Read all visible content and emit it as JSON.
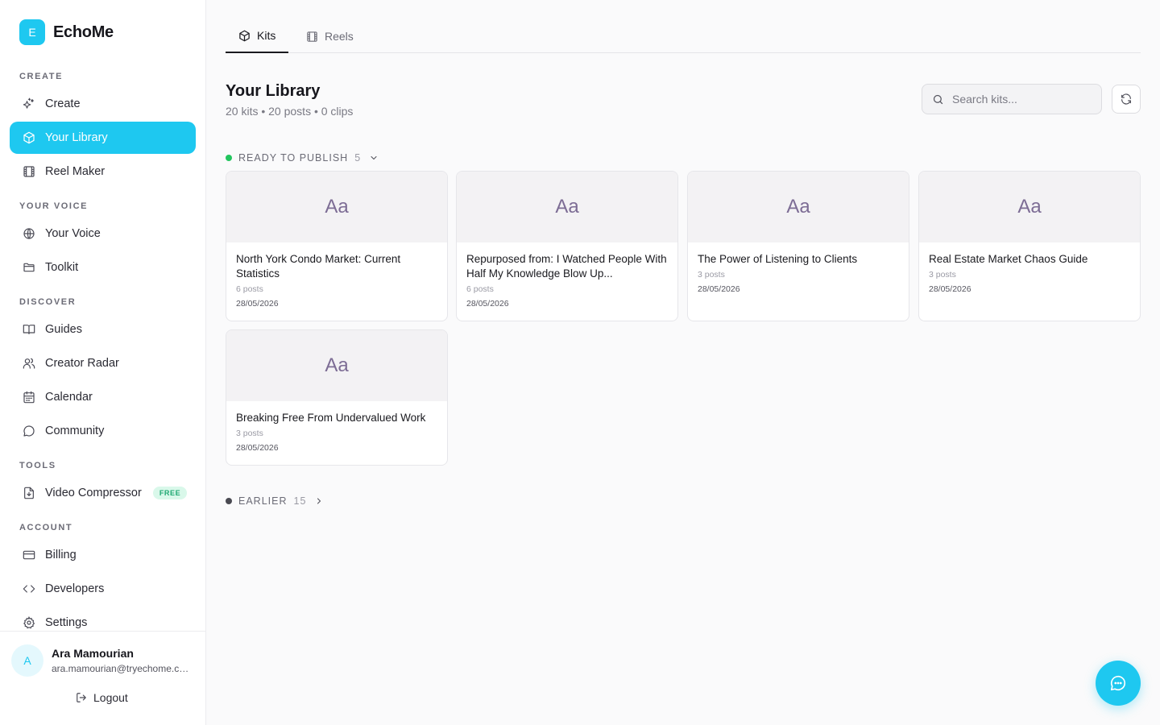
{
  "brand": {
    "logo_letter": "E",
    "name": "EchoMe",
    "accent": "#1ec8f0"
  },
  "sidebar": {
    "sections": {
      "create": "CREATE",
      "your_voice": "YOUR VOICE",
      "discover": "DISCOVER",
      "tools": "TOOLS",
      "account": "ACCOUNT"
    },
    "items": {
      "create": {
        "label": "Create",
        "icon": "sparkles-icon"
      },
      "library": {
        "label": "Your Library",
        "icon": "box-icon",
        "active": true
      },
      "reel_maker": {
        "label": "Reel Maker",
        "icon": "film-icon"
      },
      "your_voice": {
        "label": "Your Voice",
        "icon": "globe-icon"
      },
      "toolkit": {
        "label": "Toolkit",
        "icon": "folder-icon"
      },
      "guides": {
        "label": "Guides",
        "icon": "book-icon"
      },
      "creator_radar": {
        "label": "Creator Radar",
        "icon": "users-icon"
      },
      "calendar": {
        "label": "Calendar",
        "icon": "calendar-icon"
      },
      "community": {
        "label": "Community",
        "icon": "message-circle-icon"
      },
      "video_compressor": {
        "label": "Video Compressor",
        "icon": "file-download-icon",
        "badge": "FREE"
      },
      "billing": {
        "label": "Billing",
        "icon": "credit-card-icon"
      },
      "developers": {
        "label": "Developers",
        "icon": "code-icon"
      },
      "settings": {
        "label": "Settings",
        "icon": "gear-icon"
      }
    }
  },
  "user": {
    "avatar_letter": "A",
    "name": "Ara Mamourian",
    "email": "ara.mamourian@tryechome.com",
    "logout_label": "Logout"
  },
  "tabs": [
    {
      "label": "Kits",
      "icon": "box-icon",
      "active": true
    },
    {
      "label": "Reels",
      "icon": "film-icon",
      "active": false
    }
  ],
  "library": {
    "title": "Your Library",
    "subtitle": "20 kits • 20 posts • 0 clips",
    "search_placeholder": "Search kits...",
    "groups": {
      "ready": {
        "label": "READY TO PUBLISH",
        "count": "5",
        "dot_color": "#22c55e",
        "expanded": true
      },
      "earlier": {
        "label": "EARLIER",
        "count": "15",
        "dot_color": "#4a4a52",
        "expanded": false
      }
    },
    "kits": [
      {
        "thumb": "Aa",
        "title": "North York Condo Market: Current Statistics",
        "posts": "6 posts",
        "date": "28/05/2026"
      },
      {
        "thumb": "Aa",
        "title": "Repurposed from: I Watched People With Half My Knowledge Blow Up...",
        "posts": "6 posts",
        "date": "28/05/2026"
      },
      {
        "thumb": "Aa",
        "title": "The Power of Listening to Clients",
        "posts": "3 posts",
        "date": "28/05/2026"
      },
      {
        "thumb": "Aa",
        "title": "Real Estate Market Chaos Guide",
        "posts": "3 posts",
        "date": "28/05/2026"
      },
      {
        "thumb": "Aa",
        "title": "Breaking Free From Undervalued Work",
        "posts": "3 posts",
        "date": "28/05/2026"
      }
    ]
  }
}
